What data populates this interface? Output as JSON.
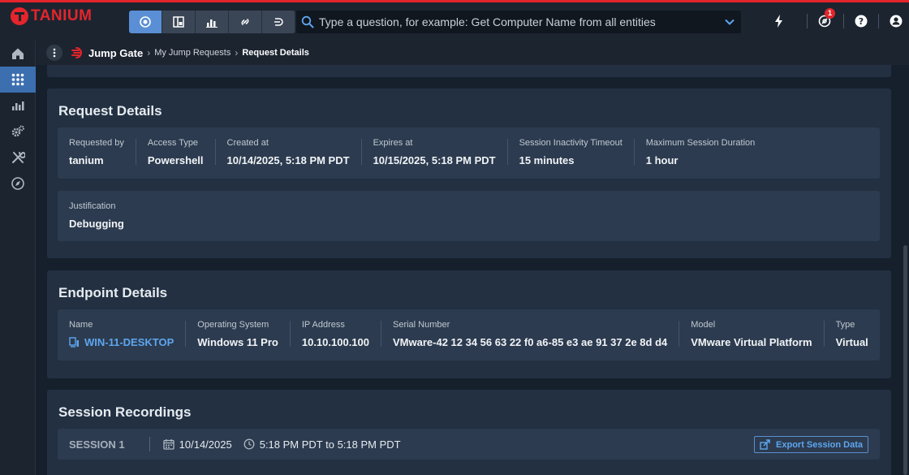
{
  "brand": {
    "name": "TANIUM",
    "accent": "#e4252b"
  },
  "search": {
    "placeholder": "Type a question, for example: Get Computer Name from all entities"
  },
  "notifications": {
    "count": "1"
  },
  "breadcrumb": {
    "root": "Jump Gate",
    "items": [
      "My Jump Requests",
      "Request Details"
    ]
  },
  "request_details": {
    "title": "Request Details",
    "fields": [
      {
        "label": "Requested by",
        "value": "tanium"
      },
      {
        "label": "Access Type",
        "value": "Powershell"
      },
      {
        "label": "Created at",
        "value": "10/14/2025, 5:18 PM PDT"
      },
      {
        "label": "Expires at",
        "value": "10/15/2025, 5:18 PM PDT"
      },
      {
        "label": "Session Inactivity Timeout",
        "value": "15 minutes"
      },
      {
        "label": "Maximum Session Duration",
        "value": "1 hour"
      }
    ],
    "justification": {
      "label": "Justification",
      "value": "Debugging"
    }
  },
  "endpoint_details": {
    "title": "Endpoint Details",
    "fields": [
      {
        "label": "Name",
        "value": "WIN-11-DESKTOP"
      },
      {
        "label": "Operating System",
        "value": "Windows 11 Pro"
      },
      {
        "label": "IP Address",
        "value": "10.10.100.100"
      },
      {
        "label": "Serial Number",
        "value": "VMware-42 12 34 56 63 22 f0 a6-85 e3 ae 91 37 2e 8d d4"
      },
      {
        "label": "Model",
        "value": "VMware Virtual Platform"
      },
      {
        "label": "Type",
        "value": "Virtual"
      }
    ]
  },
  "session_recordings": {
    "title": "Session Recordings",
    "sessions": [
      {
        "label": "SESSION 1",
        "date": "10/14/2025",
        "time": "5:18 PM PDT to 5:18 PM PDT"
      }
    ],
    "export_label": "Export Session Data"
  }
}
